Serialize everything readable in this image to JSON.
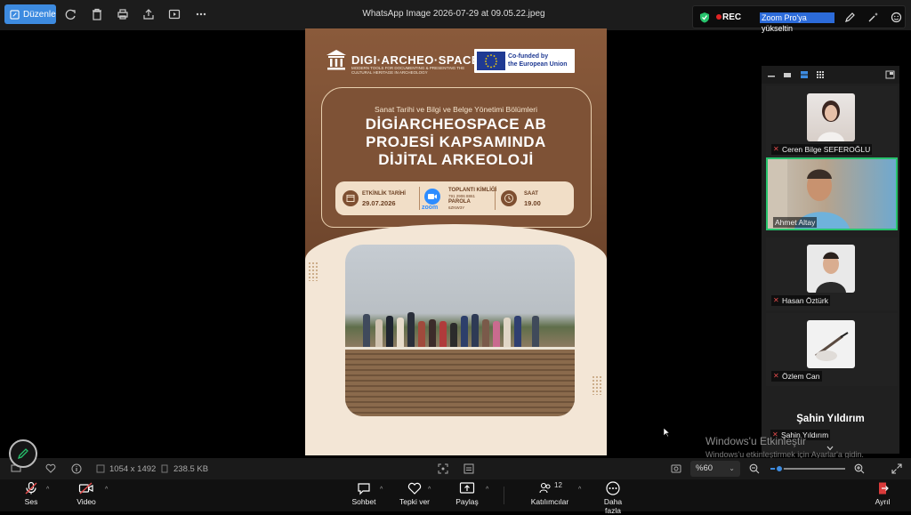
{
  "toolbar": {
    "edit_label": "Düzenle",
    "title": "WhatsApp Image 2026-07-29 at 09.05.22.jpeg"
  },
  "zoom_float": {
    "rec_label": "REC",
    "upgrade_label": "Zoom Pro'ya yükseltin"
  },
  "poster": {
    "logo_text": "DIGI·ARCHEO·SPACE",
    "logo_subtitle": "MODERN TOOLS FOR DOCUMENTING & PRESENTING THE CULTURAL HERITAGE IN ARCHEOLOGY",
    "eu_line1": "Co-funded by",
    "eu_line2": "the European Union",
    "subtitle": "Sanat Tarihi ve Bilgi ve Belge Yönetimi Bölümleri",
    "headline1": "DİGİARCHEOSPACE AB",
    "headline2": "PROJESİ KAPSAMINDA",
    "headline3": "DİJİTAL ARKEOLOJİ",
    "date_label": "ETKİNLİK TARİHİ",
    "date_value": "29.07.2026",
    "zoom_word": "zoom",
    "meeting_label": "TOPLANTI KİMLİĞİ",
    "meeting_id": "791 2906 8861",
    "password_label": "PAROLA",
    "password_value": "6ZNW3Y",
    "time_label": "SAAT",
    "time_value": "19.00"
  },
  "participants": [
    {
      "name": "Ceren Bilge SEFEROĞLU",
      "muted": true
    },
    {
      "name": "Ahmet Altay",
      "muted": false,
      "active": true
    },
    {
      "name": "Hasan Öztürk",
      "muted": true
    },
    {
      "name": "Özlem Can",
      "muted": true
    },
    {
      "name": "Şahin Yıldırım",
      "muted": true
    }
  ],
  "active_speaker": "Şahin Yıldırım",
  "watermark": {
    "line1": "Windows'u Etkinleştir",
    "line2": "Windows'u etkinleştirmek için Ayarlar'a gidin."
  },
  "status": {
    "dimensions": "1054 x 1492",
    "size": "238.5 KB",
    "zoom_level": "%60",
    "zoom_fraction": 0.12
  },
  "bottom": {
    "audio": "Ses",
    "video": "Video",
    "chat": "Sohbet",
    "react": "Tepki ver",
    "share": "Paylaş",
    "participants": "Katılımcılar",
    "participants_count": "12",
    "more": "Daha fazla",
    "leave": "Ayrıl"
  },
  "colors": {
    "accent": "#3d8be0",
    "poster_brown": "#7b5034",
    "active_border": "#27c36d",
    "muted_red": "#e24b4b"
  }
}
